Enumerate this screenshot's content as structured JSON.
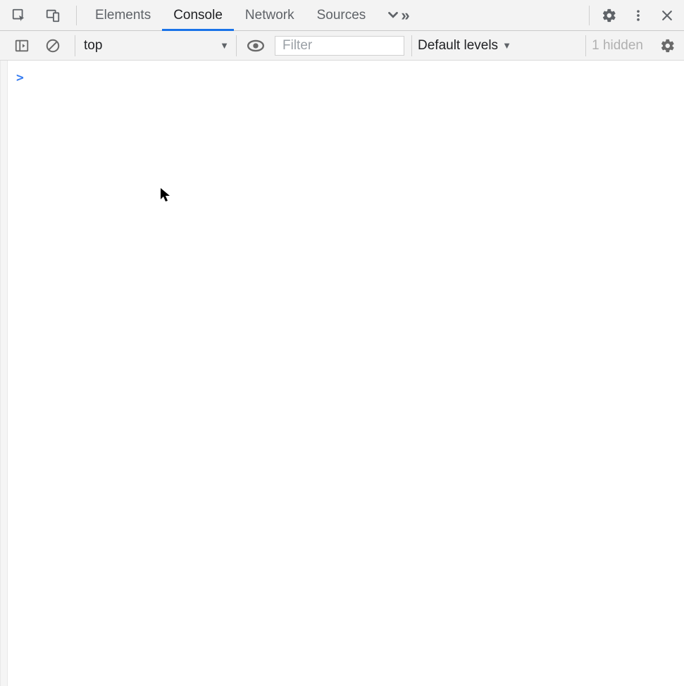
{
  "tabs": {
    "items": [
      "Elements",
      "Console",
      "Network",
      "Sources"
    ],
    "active_index": 1
  },
  "toolbar": {
    "context": "top",
    "filter_placeholder": "Filter",
    "levels_label": "Default levels",
    "hidden_label": "1 hidden"
  },
  "console": {
    "prompt": ">"
  }
}
